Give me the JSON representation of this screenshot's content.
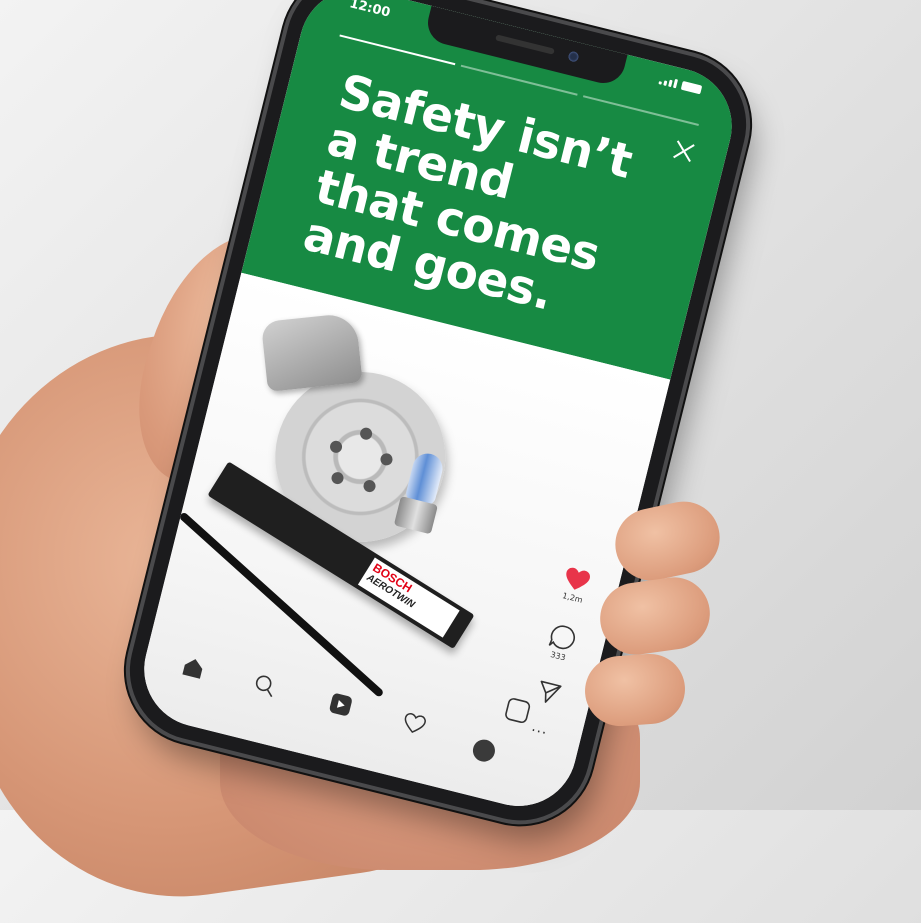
{
  "status_bar": {
    "time": "12:00"
  },
  "story": {
    "progress_segments": 3,
    "active_segment": 1,
    "headline_lines": [
      "Safety isn’t",
      "a trend",
      "that comes",
      "and goes."
    ],
    "background_color": "#178a43"
  },
  "product_image": {
    "box_brand": "BOSCH",
    "box_product": "AEROTWIN"
  },
  "actions": {
    "likes": "1,2m",
    "comments": "333",
    "heart_color": "#e8344a"
  },
  "icons": {
    "close": "close-icon",
    "heart": "heart-icon",
    "comment": "comment-icon",
    "share": "send-icon",
    "more": "more-icon",
    "home": "home-icon",
    "search": "search-icon",
    "reels": "reels-icon",
    "activity": "heart-outline-icon",
    "profile": "profile-icon",
    "new_post": "new-post-icon"
  }
}
